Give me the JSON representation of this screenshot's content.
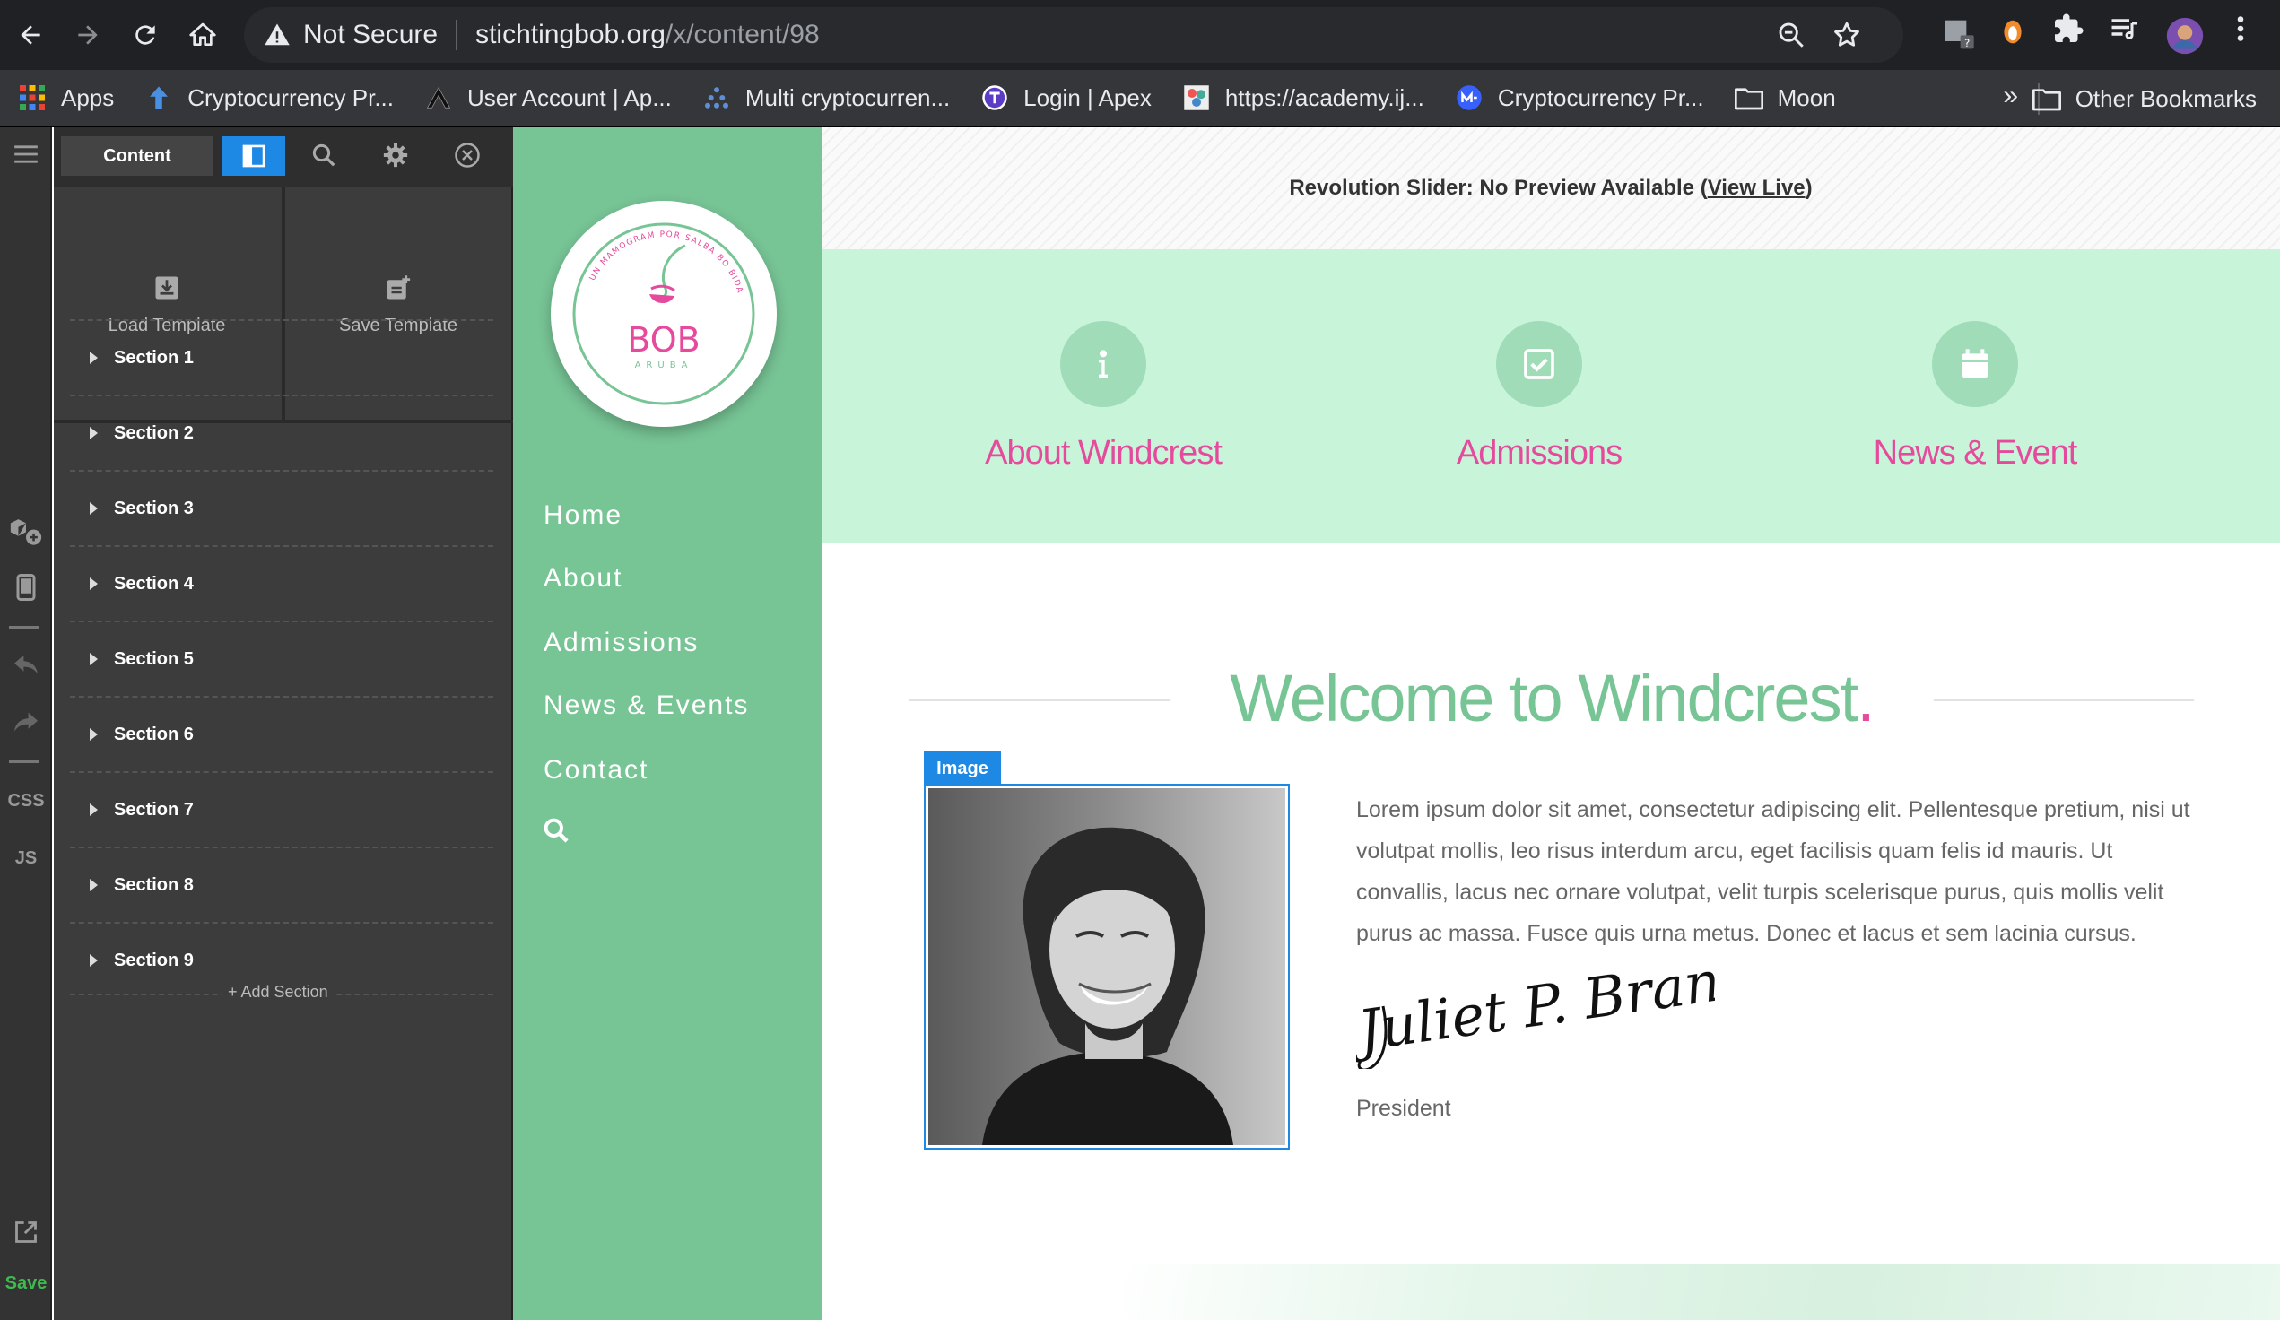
{
  "browser": {
    "security_label": "Not Secure",
    "url_host": "stichtingbob.org",
    "url_path": "/x/content/98",
    "bookmarks": [
      {
        "label": "Apps",
        "icon": "apps-grid-icon"
      },
      {
        "label": "Cryptocurrency Pr...",
        "icon": "up-arrow-icon"
      },
      {
        "label": "User Account | Ap...",
        "icon": "apex-logo-icon"
      },
      {
        "label": "Multi cryptocurren...",
        "icon": "dots-icon"
      },
      {
        "label": "Login | Apex",
        "icon": "t-logo-icon"
      },
      {
        "label": "https://academy.ij...",
        "icon": "academy-icon"
      },
      {
        "label": "Cryptocurrency Pr...",
        "icon": "coinmarket-icon"
      },
      {
        "label": "Moon",
        "icon": "folder-icon"
      }
    ],
    "other_bookmarks": "Other Bookmarks",
    "more": "»"
  },
  "rail": {
    "css_label": "CSS",
    "js_label": "JS",
    "save_label": "Save"
  },
  "panel": {
    "tab_content": "Content",
    "load_template": "Load Template",
    "save_template": "Save Template",
    "sections": [
      "Section 1",
      "Section 2",
      "Section 3",
      "Section 4",
      "Section 5",
      "Section 6",
      "Section 7",
      "Section 8",
      "Section 9"
    ],
    "add_section": "+ Add Section"
  },
  "site": {
    "logo_text": "BOB",
    "logo_sub": "ARUBA",
    "logo_ring": "UN MAMOGRAM POR SALBA BO BIDA",
    "nav": [
      "Home",
      "About",
      "Admissions",
      "News & Events",
      "Contact"
    ],
    "slider_note_prefix": "Revolution Slider: No Preview Available (",
    "slider_note_link": "View Live",
    "slider_note_suffix": ")",
    "features": [
      {
        "title": "About Windcrest",
        "icon": "info-icon"
      },
      {
        "title": "Admissions",
        "icon": "checkbox-icon"
      },
      {
        "title": "News & Event",
        "icon": "calendar-icon"
      }
    ],
    "welcome_title": "Welcome to Windcrest",
    "welcome_dot": ".",
    "image_tag": "Image",
    "lorem": "Lorem ipsum dolor sit amet, consectetur adipiscing elit. Pellentesque pretium, nisi ut volutpat mollis, leo risus interdum arcu, eget facilisis quam felis id mauris. Ut convallis, lacus nec ornare volutpat, velit turpis scelerisque purus, quis mollis velit purus ac massa. Fusce quis urna metus. Donec et lacus et sem lacinia cursus.",
    "signature": "Juliet P. Brand",
    "role": "President"
  },
  "colors": {
    "accent_green": "#77c495",
    "feature_bg": "#c8f5da",
    "pink": "#e64a9c",
    "builder_blue": "#1e88e5"
  }
}
